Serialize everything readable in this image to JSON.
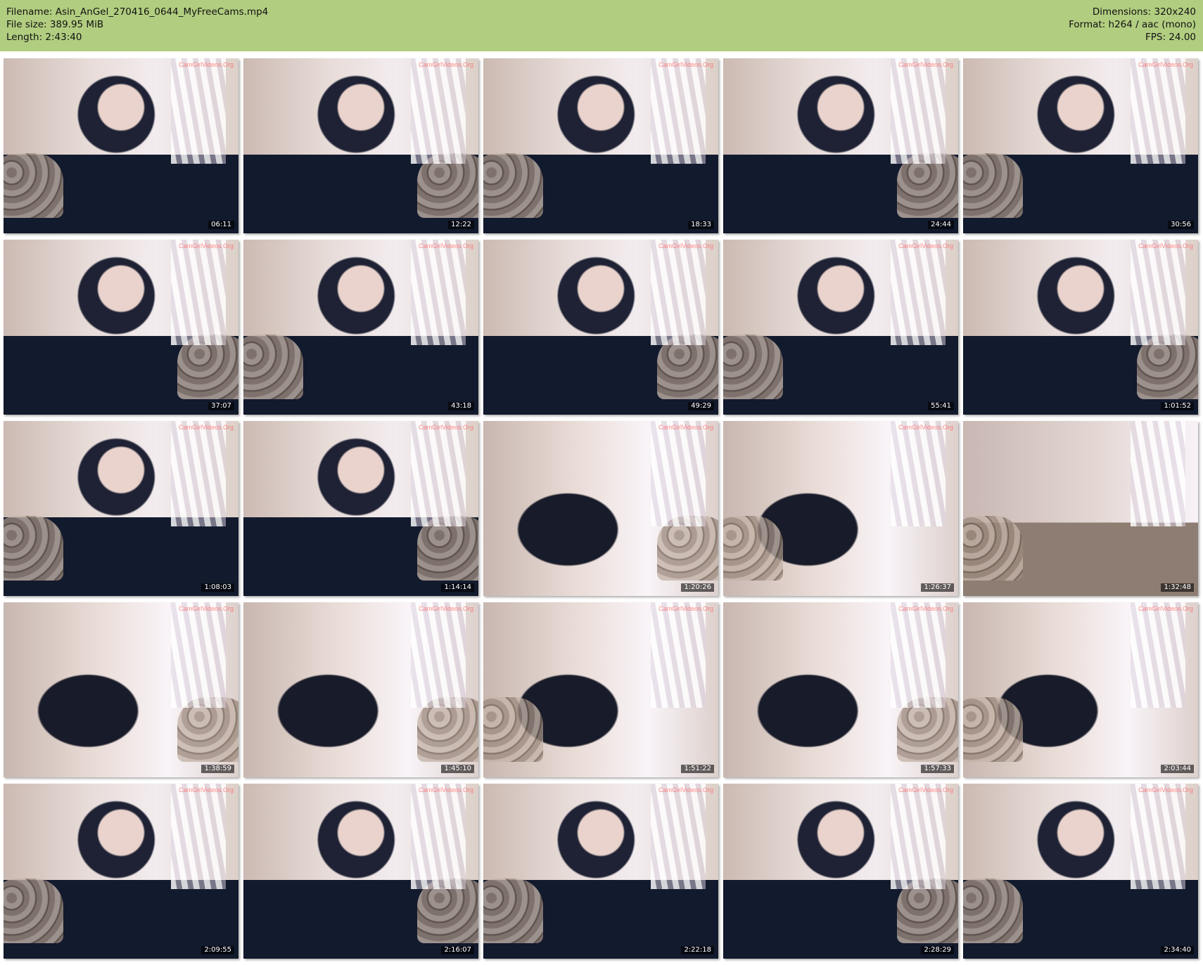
{
  "header": {
    "filename_line": "Filename: Asin_AnGel_270416_0644_MyFreeCams.mp4",
    "filesize_line": "File size: 389.95 MiB",
    "length_line": "Length: 2:43:40",
    "dimensions_line": "Dimensions: 320x240",
    "format_line": "Format: h264 / aac (mono)",
    "fps_line": "FPS: 24.00"
  },
  "thumbnails": [
    {
      "time": "06:11"
    },
    {
      "time": "12:22"
    },
    {
      "time": "18:33"
    },
    {
      "time": "24:44"
    },
    {
      "time": "30:56"
    },
    {
      "time": "37:07"
    },
    {
      "time": "43:18"
    },
    {
      "time": "49:29"
    },
    {
      "time": "55:41"
    },
    {
      "time": "1:01:52"
    },
    {
      "time": "1:08:03"
    },
    {
      "time": "1:14:14"
    },
    {
      "time": "1:20:26"
    },
    {
      "time": "1:26:37"
    },
    {
      "time": "1:32:48"
    },
    {
      "time": "1:38:59"
    },
    {
      "time": "1:45:10"
    },
    {
      "time": "1:51:22"
    },
    {
      "time": "1:57:33"
    },
    {
      "time": "2:03:44"
    },
    {
      "time": "2:09:55"
    },
    {
      "time": "2:16:07"
    },
    {
      "time": "2:22:18"
    },
    {
      "time": "2:28:29"
    },
    {
      "time": "2:34:40"
    }
  ],
  "watermark": "CamGirlVideos.Org",
  "colors": {
    "header_background": "#b1cd80",
    "timestamp_text": "#ffffff",
    "watermark": "#ff6767"
  }
}
